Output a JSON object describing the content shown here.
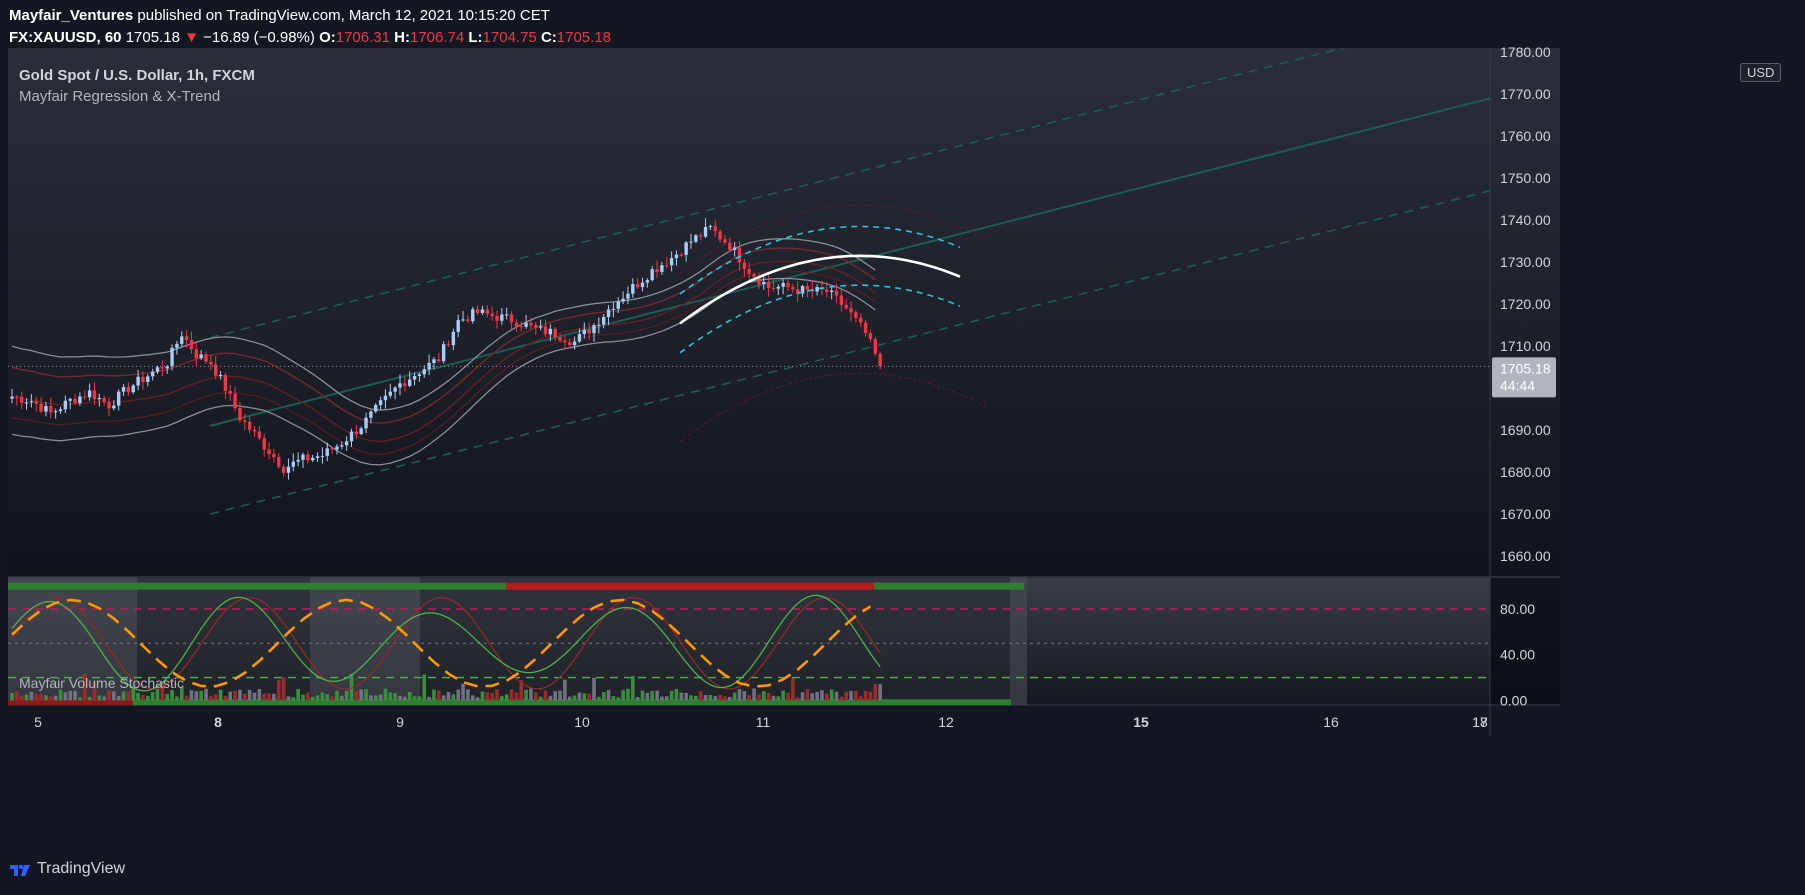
{
  "header": {
    "author": "Mayfair_Ventures",
    "published_text": " published on TradingView.com, March 12, 2021 10:15:20 CET",
    "symbol": "FX:XAUUSD, 60",
    "last": "1705.18",
    "arrow": "▼",
    "change": "−16.89 (−0.98%)",
    "o_label": "O:",
    "o": "1706.31",
    "h_label": "H:",
    "h": "1706.74",
    "l_label": "L:",
    "l": "1704.75",
    "c_label": "C:",
    "c": "1705.18"
  },
  "legend": {
    "title": "Gold Spot / U.S. Dollar, 1h, FXCM",
    "indicator": "Mayfair Regression & X-Trend",
    "currency": "USD"
  },
  "lower_pane": {
    "title": "Mayfair Volume Stochastic"
  },
  "footer": {
    "brand": "TradingView"
  },
  "price_label": {
    "price": "1705.18",
    "countdown": "44:44"
  },
  "colors": {
    "background": "#131722",
    "up": "#a9cdf7",
    "down": "#f23645",
    "regression": "#ffffff",
    "channel": "#26c6da",
    "trend": "#1f5f57"
  },
  "chart_data": [
    {
      "type": "candlestick",
      "title": "Gold Spot / U.S. Dollar, 1h, FXCM",
      "ylim": [
        1655,
        1781
      ],
      "y_ticks": [
        1660,
        1670,
        1680,
        1690,
        1700,
        1710,
        1720,
        1730,
        1740,
        1750,
        1760,
        1770,
        1780
      ],
      "x_ticks": [
        "5",
        "8",
        "9",
        "10",
        "11",
        "12",
        "15",
        "16",
        "17",
        "18"
      ],
      "last_price": 1705.18,
      "close_path": [
        [
          0,
          1698
        ],
        [
          4,
          1697
        ],
        [
          8,
          1694
        ],
        [
          12,
          1697
        ],
        [
          16,
          1699
        ],
        [
          20,
          1696
        ],
        [
          24,
          1700
        ],
        [
          28,
          1703
        ],
        [
          32,
          1706
        ],
        [
          35,
          1713
        ],
        [
          38,
          1708
        ],
        [
          41,
          1706
        ],
        [
          44,
          1700
        ],
        [
          47,
          1693
        ],
        [
          50,
          1689
        ],
        [
          53,
          1685
        ],
        [
          56,
          1681
        ],
        [
          60,
          1683
        ],
        [
          64,
          1684
        ],
        [
          68,
          1687
        ],
        [
          72,
          1691
        ],
        [
          76,
          1696
        ],
        [
          80,
          1701
        ],
        [
          84,
          1704
        ],
        [
          88,
          1707
        ],
        [
          92,
          1716
        ],
        [
          96,
          1718
        ],
        [
          100,
          1717
        ],
        [
          104,
          1716
        ],
        [
          108,
          1714
        ],
        [
          112,
          1713
        ],
        [
          116,
          1711
        ],
        [
          120,
          1715
        ],
        [
          124,
          1720
        ],
        [
          128,
          1724
        ],
        [
          132,
          1728
        ],
        [
          136,
          1731
        ],
        [
          140,
          1735
        ],
        [
          144,
          1738
        ],
        [
          148,
          1734
        ],
        [
          152,
          1728
        ],
        [
          156,
          1724
        ],
        [
          160,
          1724
        ],
        [
          164,
          1723
        ],
        [
          168,
          1723
        ],
        [
          172,
          1719
        ],
        [
          176,
          1713
        ],
        [
          179,
          1705.18
        ]
      ],
      "volume_stochastic": {
        "ylim": [
          -4,
          108
        ],
        "y_ticks": [
          0,
          40,
          80
        ],
        "y_tick_labels": [
          "0.00",
          "40.00",
          "80.00"
        ],
        "levels": [
          80,
          50,
          20
        ]
      }
    }
  ]
}
